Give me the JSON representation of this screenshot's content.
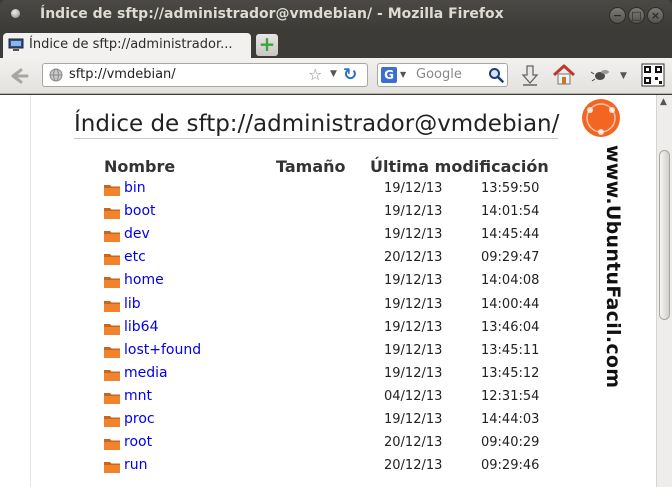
{
  "window": {
    "title": "Índice de sftp://administrador@vmdebian/ - Mozilla Firefox",
    "buttons": {
      "minimize": "−",
      "maximize": "□",
      "close": "×"
    }
  },
  "tabs": [
    {
      "label": "Índice de sftp://administrador...",
      "favicon": "computer-icon"
    }
  ],
  "new_tab": "+",
  "navbar": {
    "url": "sftp://vmdebian/",
    "search_placeholder": "Google",
    "search_engine": "G"
  },
  "page": {
    "heading": "Índice de sftp://administrador@vmdebian/",
    "columns": {
      "name": "Nombre",
      "size": "Tamaño",
      "modified": "Última modificación"
    },
    "rows": [
      {
        "name": "bin",
        "date": "19/12/13",
        "time": "13:59:50"
      },
      {
        "name": "boot",
        "date": "19/12/13",
        "time": "14:01:54"
      },
      {
        "name": "dev",
        "date": "19/12/13",
        "time": "14:45:44"
      },
      {
        "name": "etc",
        "date": "20/12/13",
        "time": "09:29:47"
      },
      {
        "name": "home",
        "date": "19/12/13",
        "time": "14:04:08"
      },
      {
        "name": "lib",
        "date": "19/12/13",
        "time": "14:00:44"
      },
      {
        "name": "lib64",
        "date": "19/12/13",
        "time": "13:46:04"
      },
      {
        "name": "lost+found",
        "date": "19/12/13",
        "time": "13:45:11"
      },
      {
        "name": "media",
        "date": "19/12/13",
        "time": "13:45:12"
      },
      {
        "name": "mnt",
        "date": "04/12/13",
        "time": "12:31:54"
      },
      {
        "name": "proc",
        "date": "19/12/13",
        "time": "14:44:03"
      },
      {
        "name": "root",
        "date": "20/12/13",
        "time": "09:40:29"
      },
      {
        "name": "run",
        "date": "20/12/13",
        "time": "09:29:46"
      }
    ]
  },
  "watermark": {
    "badge_text": "Ubuntu Fácil",
    "vertical_text": "www.UbuntuFacil.com",
    "badge_color": "#f26522"
  },
  "colors": {
    "link": "#0000ee",
    "folder": "#f0832c",
    "titlebar": "#3c3b37"
  }
}
